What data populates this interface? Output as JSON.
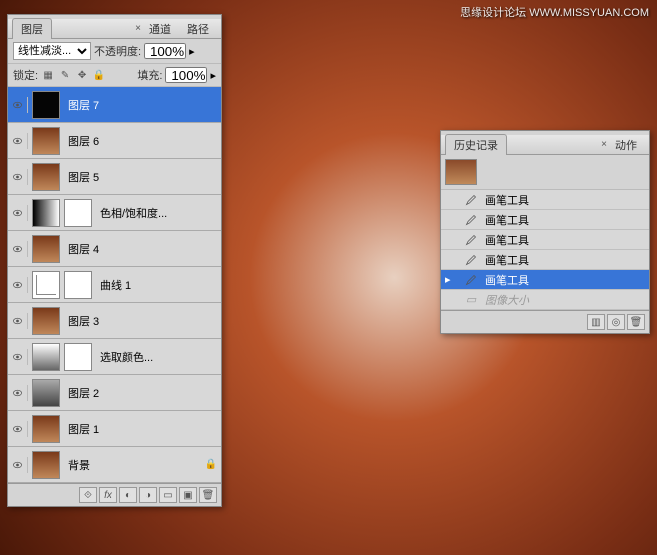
{
  "watermark": "思缘设计论坛  WWW.MISSYUAN.COM",
  "layers_panel": {
    "tabs": [
      "图层",
      "通道",
      "路径"
    ],
    "active_tab": 0,
    "blend_mode": "线性减淡...",
    "opacity_label": "不透明度:",
    "opacity_value": "100%",
    "lock_label": "锁定:",
    "fill_label": "填充:",
    "fill_value": "100%",
    "layers": [
      {
        "name": "图层 7",
        "thumbs": [
          "dark"
        ],
        "selected": true
      },
      {
        "name": "图层 6",
        "thumbs": [
          "img"
        ]
      },
      {
        "name": "图层 5",
        "thumbs": [
          "img"
        ]
      },
      {
        "name": "色相/饱和度...",
        "thumbs": [
          "grad",
          "mask"
        ]
      },
      {
        "name": "图层 4",
        "thumbs": [
          "img"
        ]
      },
      {
        "name": "曲线 1",
        "thumbs": [
          "curves",
          "mask"
        ]
      },
      {
        "name": "图层 3",
        "thumbs": [
          "img"
        ]
      },
      {
        "name": "选取颜色...",
        "thumbs": [
          "adj",
          "mask"
        ]
      },
      {
        "name": "图层 2",
        "thumbs": [
          "bw"
        ]
      },
      {
        "name": "图层 1",
        "thumbs": [
          "img"
        ]
      },
      {
        "name": "背景",
        "thumbs": [
          "img"
        ],
        "locked": true
      }
    ]
  },
  "history_panel": {
    "tabs": [
      "历史记录",
      "动作"
    ],
    "active_tab": 0,
    "items": [
      {
        "label": "画笔工具",
        "icon": "brush"
      },
      {
        "label": "画笔工具",
        "icon": "brush"
      },
      {
        "label": "画笔工具",
        "icon": "brush"
      },
      {
        "label": "画笔工具",
        "icon": "brush"
      },
      {
        "label": "画笔工具",
        "icon": "brush",
        "selected": true
      },
      {
        "label": "图像大小",
        "icon": "resize",
        "muted": true
      }
    ]
  }
}
